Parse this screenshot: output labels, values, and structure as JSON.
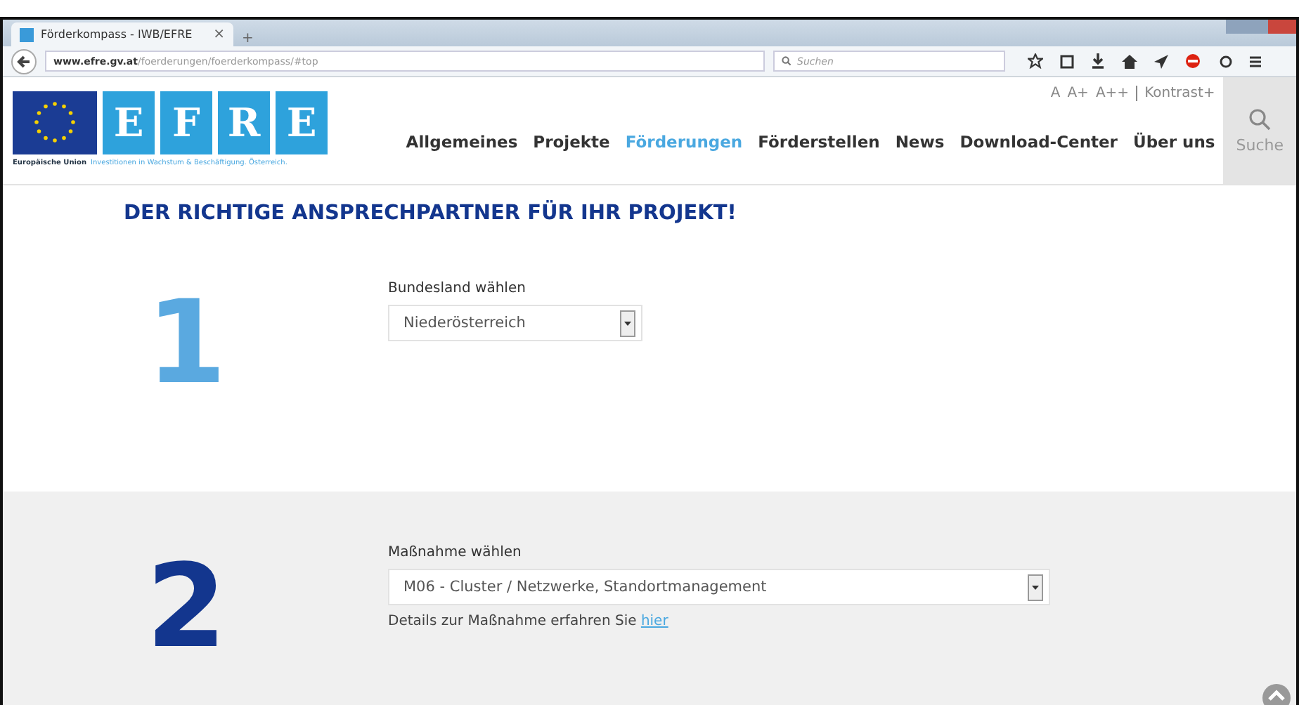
{
  "browser": {
    "tab": {
      "title": "Förderkompass - IWB/EFRE",
      "close": "×"
    },
    "new_tab": "+",
    "url_host": "www.efre.gv.at",
    "url_path": "/foerderungen/foerderkompass/#top",
    "search_placeholder": "Suchen"
  },
  "site": {
    "logo_letters": [
      "E",
      "F",
      "R",
      "E"
    ],
    "logo_caption": [
      "Europäische Union",
      "Investitionen in Wachstum & Beschäftigung. Österreich."
    ],
    "font_sizes": [
      "A",
      "A+",
      "A++"
    ],
    "contrast": "Kontrast+",
    "nav": [
      {
        "label": "Allgemeines",
        "selected": false
      },
      {
        "label": "Projekte",
        "selected": false
      },
      {
        "label": "Förderungen",
        "selected": true
      },
      {
        "label": "Förderstellen",
        "selected": false
      },
      {
        "label": "News",
        "selected": false
      },
      {
        "label": "Download-Center",
        "selected": false
      },
      {
        "label": "Über uns",
        "selected": false
      }
    ],
    "search_label": "Suche"
  },
  "heading": "DER RICHTIGE ANSPRECHPARTNER FÜR IHR PROJEKT!",
  "steps": [
    {
      "number": "1",
      "color": "#5aa9e0",
      "label": "Bundesland wählen",
      "value": "Niederösterreich",
      "wide": false
    },
    {
      "number": "2",
      "color": "#13368e",
      "label": "Maßnahme wählen",
      "value": "M06 - Cluster / Netzwerke, Standortmanagement",
      "wide": true,
      "details": "Details zur Maßnahme erfahren Sie",
      "link": "hier"
    }
  ]
}
